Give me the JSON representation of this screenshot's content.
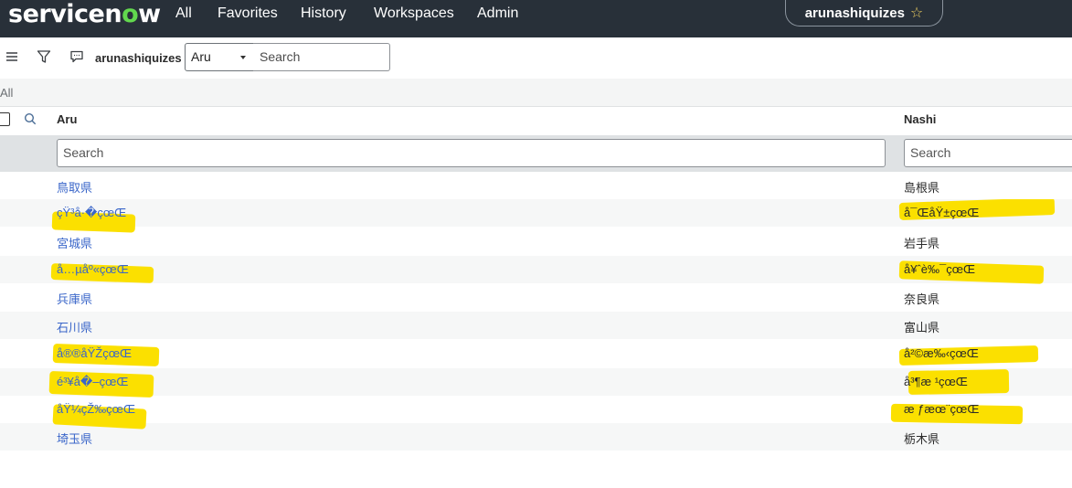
{
  "nav": {
    "logo": "servicenow",
    "items": [
      "All",
      "Favorites",
      "History",
      "Workspaces",
      "Admin"
    ],
    "instance_pill": "arunashiquizes"
  },
  "toolbar": {
    "title": "arunashiquizes",
    "field_select": "Aru",
    "search_placeholder": "Search"
  },
  "breadcrumb": "All",
  "columns": {
    "aru": "Aru",
    "nashi": "Nashi",
    "search_placeholder": "Search"
  },
  "rows": [
    {
      "aru": "鳥取県",
      "nashi": "島根県"
    },
    {
      "aru": "çŸ³å·�çœŒ",
      "nashi": "å¯ŒåŸ±çœŒ"
    },
    {
      "aru": "宮城県",
      "nashi": "岩手県"
    },
    {
      "aru": "å…µåº«çœŒ",
      "nashi": "å¥ˆè‰¯çœŒ"
    },
    {
      "aru": "兵庫県",
      "nashi": "奈良県"
    },
    {
      "aru": "石川県",
      "nashi": "富山県"
    },
    {
      "aru": "å®®åŸŽçœŒ",
      "nashi": "å²©æ‰‹çœŒ"
    },
    {
      "aru": "é³¥å�–çœŒ",
      "nashi": "å³¶æ ¹çœŒ"
    },
    {
      "aru": "åŸ¼çŽ‰çœŒ",
      "nashi": "æ ƒæœ¨çœŒ"
    },
    {
      "aru": "埼玉県",
      "nashi": "栃木県"
    }
  ],
  "colors": {
    "nav_bg": "#283039",
    "logo_accent": "#62d84e",
    "link": "#3a66c9",
    "highlight": "#fbe000"
  }
}
